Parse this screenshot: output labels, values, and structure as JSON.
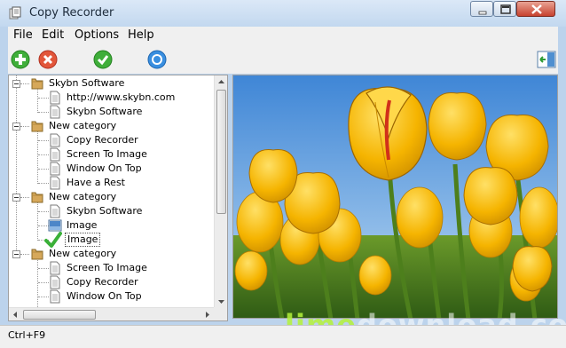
{
  "window": {
    "title": "Copy Recorder"
  },
  "menu": [
    "File",
    "Edit",
    "Options",
    "Help"
  ],
  "toolbar": {
    "add": "plus-icon",
    "delete": "x-icon",
    "apply": "check-icon",
    "record": "circle-icon",
    "panel": "panel-toggle-icon"
  },
  "tree": {
    "nodes": [
      {
        "label": "Skybn Software",
        "kind": "category"
      },
      {
        "label": "http://www.skybn.com",
        "kind": "text"
      },
      {
        "label": "Skybn Software",
        "kind": "text"
      },
      {
        "label": "New category",
        "kind": "category"
      },
      {
        "label": "Copy Recorder",
        "kind": "text"
      },
      {
        "label": "Screen To Image",
        "kind": "text"
      },
      {
        "label": "Window On Top",
        "kind": "text"
      },
      {
        "label": "Have a Rest",
        "kind": "text"
      },
      {
        "label": "New category",
        "kind": "category"
      },
      {
        "label": "Skybn Software",
        "kind": "text"
      },
      {
        "label": "Image",
        "kind": "image"
      },
      {
        "label": "Image",
        "kind": "image-selected"
      },
      {
        "label": "New category",
        "kind": "category"
      },
      {
        "label": "Screen To Image",
        "kind": "text"
      },
      {
        "label": "Copy Recorder",
        "kind": "text"
      },
      {
        "label": "Window On Top",
        "kind": "text"
      }
    ]
  },
  "watermark": {
    "part1": "lime",
    "part2": "download.com"
  },
  "status": {
    "text": "Ctrl+F9"
  },
  "colors": {
    "accent": "#f5b400",
    "sky": "#5a98dc"
  }
}
